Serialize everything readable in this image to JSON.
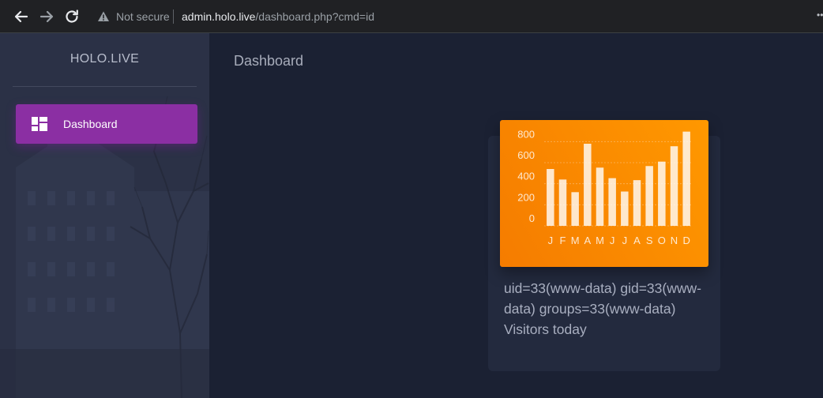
{
  "browser": {
    "security_label": "Not secure",
    "url_host": "admin.holo.live",
    "url_path": "/dashboard.php?cmd=id",
    "icons": [
      "back-arrow-icon",
      "forward-arrow-icon",
      "reload-icon",
      "warning-triangle-icon"
    ]
  },
  "sidebar": {
    "brand": "HOLO.LIVE",
    "items": [
      {
        "label": "Dashboard",
        "icon": "dashboard-icon",
        "active": true
      }
    ],
    "active_color": "#8b2fa3"
  },
  "header": {
    "title": "Dashboard"
  },
  "card": {
    "output_text": "uid=33(www-data) gid=33(www-data) groups=33(www-data) Visitors today",
    "chart_bg": "#ff9800"
  },
  "chart_data": {
    "type": "bar",
    "categories": [
      "J",
      "F",
      "M",
      "A",
      "M",
      "J",
      "J",
      "A",
      "S",
      "O",
      "N",
      "D"
    ],
    "values": [
      540,
      440,
      320,
      780,
      553,
      453,
      326,
      434,
      568,
      610,
      756,
      895
    ],
    "y_ticks": [
      "0",
      "200",
      "400",
      "600",
      "800"
    ],
    "ylim": [
      0,
      900
    ],
    "grid": "dotted horizontal",
    "bar_color": "rgba(255,255,255,0.8)"
  }
}
